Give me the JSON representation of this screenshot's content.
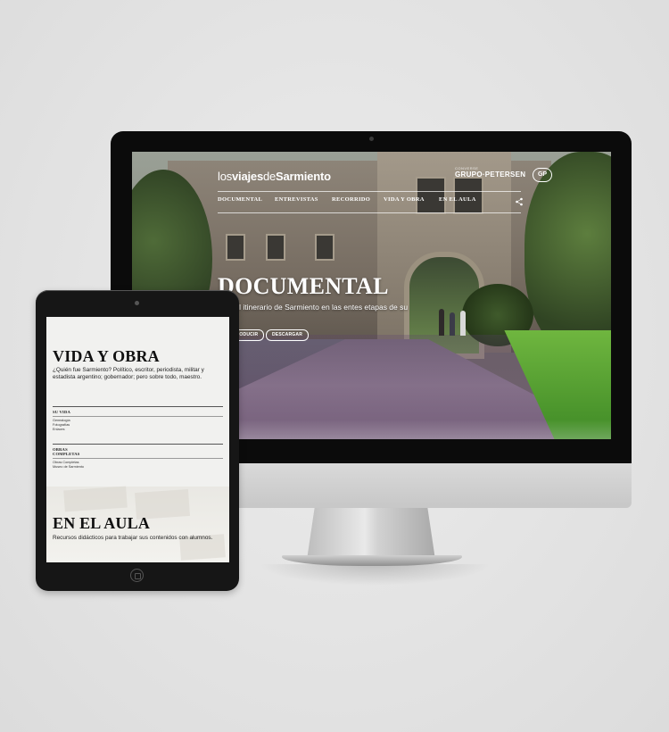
{
  "desktop_site": {
    "logo_part1": "los",
    "logo_part2": "viajes",
    "logo_part3": "de",
    "logo_part4": "Sarmiento",
    "sponsor_top": "CONVERSE",
    "sponsor_name": "GRUPO·PETERSEN",
    "sponsor_mark": "GP",
    "nav": [
      "DOCUMENTAL",
      "ENTREVISTAS",
      "RECORRIDO",
      "VIDA Y OBRA",
      "EN EL AULA"
    ],
    "hero_title": "DOCUMENTAL",
    "hero_sub": "ubre el itinerario de Sarmiento en las entes etapas de su vida.",
    "btn_left": "RODUCIR",
    "btn_right": "DESCARGAR"
  },
  "tablet_site": {
    "title": "VIDA Y OBRA",
    "description": "¿Quién fue Sarmiento? Político, escritor, periodista, militar y estadista argentino; gobernador; pero sobre todo, maestro.",
    "section1_title": "SU VIDA",
    "section1_items": [
      "Genealogía",
      "Fotografías",
      "Enlaces"
    ],
    "section2_title_line1": "OBRAS",
    "section2_title_line2": "COMPLETAS",
    "section2_items": [
      "Obras Completas",
      "Museo de Sarmiento"
    ],
    "aula_title": "EN EL AULA",
    "aula_description": "Recursos didácticos para trabajar sus contenidos con alumnos."
  }
}
